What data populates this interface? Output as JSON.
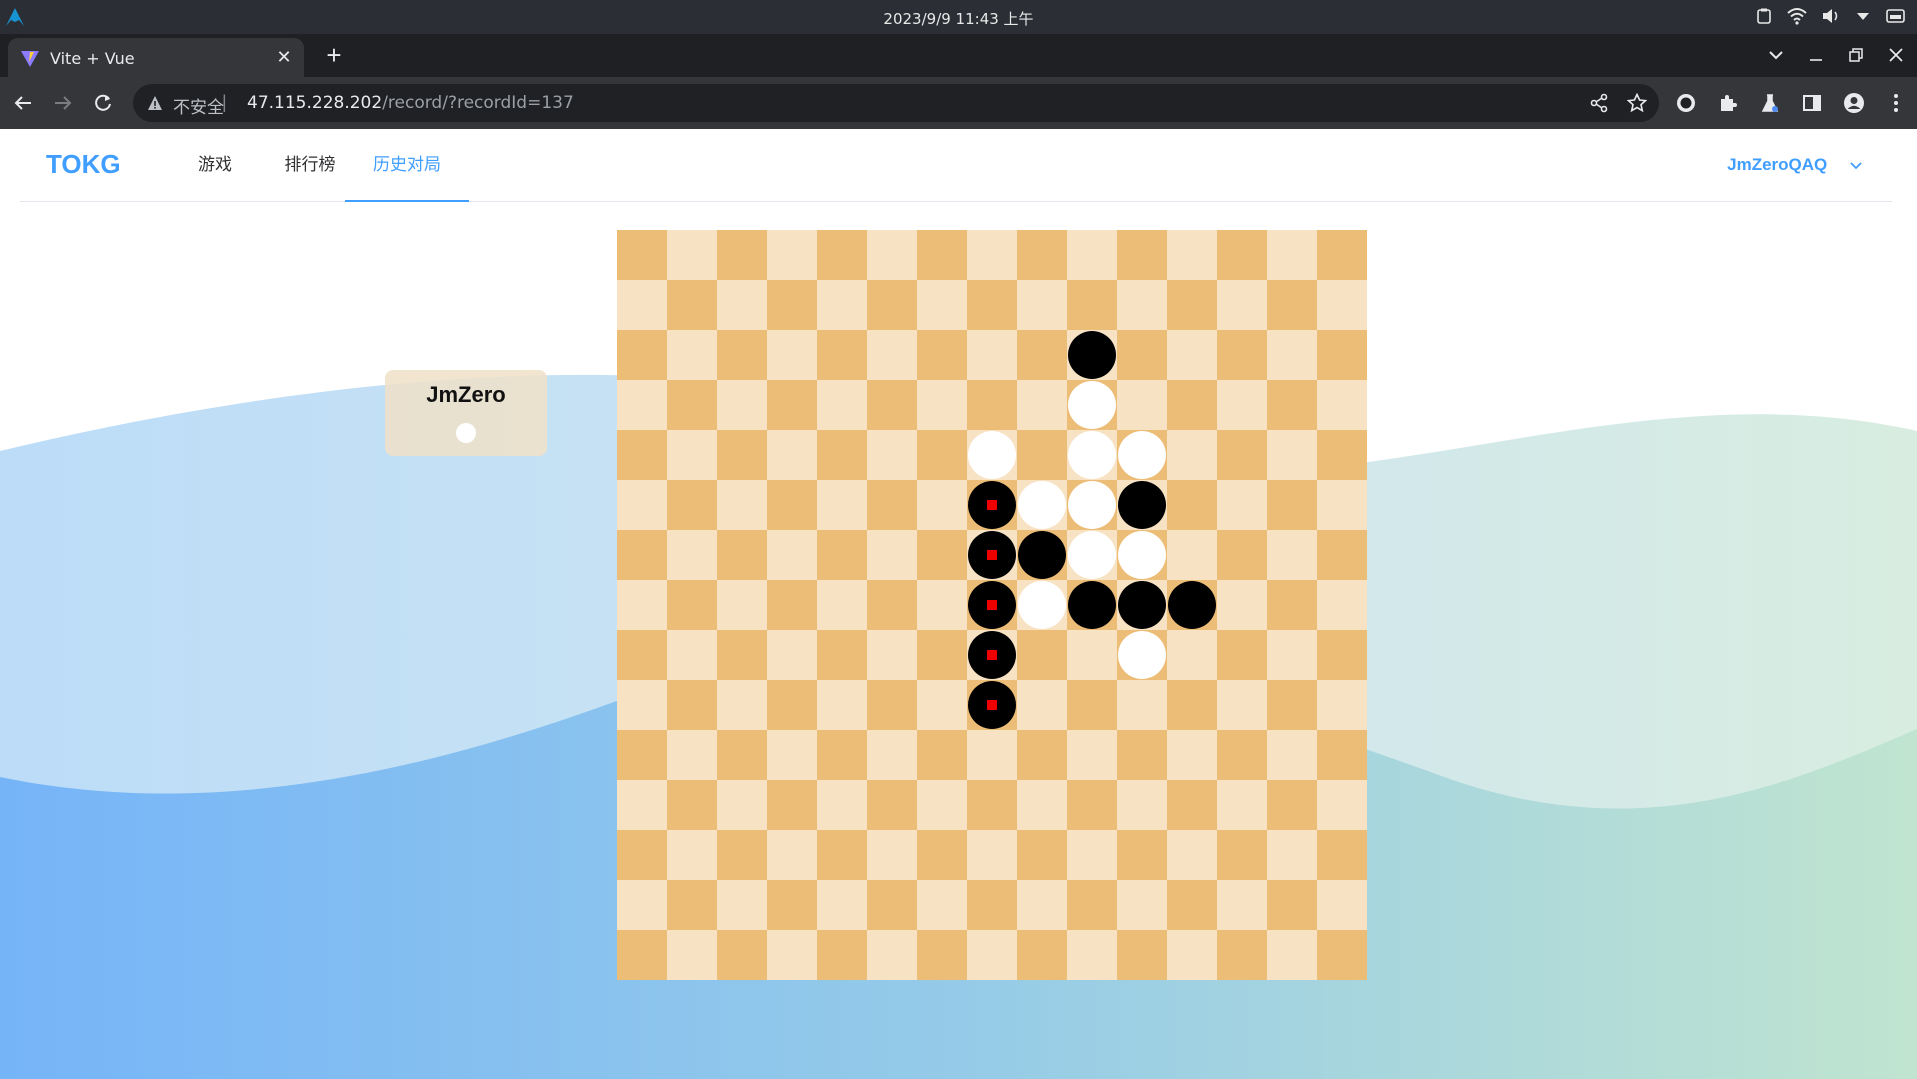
{
  "os": {
    "datetime": "2023/9/9  11:43 上午",
    "tray_icons": [
      "clipboard-icon",
      "wifi-icon",
      "volume-icon",
      "dropdown-icon",
      "battery-icon"
    ]
  },
  "browser": {
    "tab": {
      "title": "Vite + Vue",
      "favicon": "vite-icon"
    },
    "address": {
      "security_label": "不安全",
      "url_host": "47.115.228.202",
      "url_path": "/record/?recordId=137"
    }
  },
  "navbar": {
    "brand": "TOKG",
    "items": [
      {
        "label": "游戏",
        "active": false
      },
      {
        "label": "排行榜",
        "active": false
      },
      {
        "label": "历史对局",
        "active": true
      }
    ],
    "user": "JmZeroQAQ"
  },
  "player": {
    "name": "JmZero",
    "stone": "white"
  },
  "board": {
    "size": 15,
    "colors": {
      "dark": "#ecbd77",
      "light": "#f8e2c4",
      "highlight": "#ee0000"
    },
    "stones": [
      {
        "row": 2,
        "col": 9,
        "color": "black",
        "marked": false
      },
      {
        "row": 3,
        "col": 9,
        "color": "white",
        "marked": false
      },
      {
        "row": 4,
        "col": 7,
        "color": "white",
        "marked": false
      },
      {
        "row": 4,
        "col": 9,
        "color": "white",
        "marked": false
      },
      {
        "row": 4,
        "col": 10,
        "color": "white",
        "marked": false
      },
      {
        "row": 5,
        "col": 7,
        "color": "black",
        "marked": true
      },
      {
        "row": 5,
        "col": 8,
        "color": "white",
        "marked": false
      },
      {
        "row": 5,
        "col": 9,
        "color": "white",
        "marked": false
      },
      {
        "row": 5,
        "col": 10,
        "color": "black",
        "marked": false
      },
      {
        "row": 6,
        "col": 7,
        "color": "black",
        "marked": true
      },
      {
        "row": 6,
        "col": 8,
        "color": "black",
        "marked": false
      },
      {
        "row": 6,
        "col": 9,
        "color": "white",
        "marked": false
      },
      {
        "row": 6,
        "col": 10,
        "color": "white",
        "marked": false
      },
      {
        "row": 7,
        "col": 7,
        "color": "black",
        "marked": true
      },
      {
        "row": 7,
        "col": 8,
        "color": "white",
        "marked": false
      },
      {
        "row": 7,
        "col": 9,
        "color": "black",
        "marked": false
      },
      {
        "row": 7,
        "col": 10,
        "color": "black",
        "marked": false
      },
      {
        "row": 7,
        "col": 11,
        "color": "black",
        "marked": false
      },
      {
        "row": 8,
        "col": 7,
        "color": "black",
        "marked": true
      },
      {
        "row": 8,
        "col": 10,
        "color": "white",
        "marked": false
      },
      {
        "row": 9,
        "col": 7,
        "color": "black",
        "marked": true
      }
    ]
  }
}
